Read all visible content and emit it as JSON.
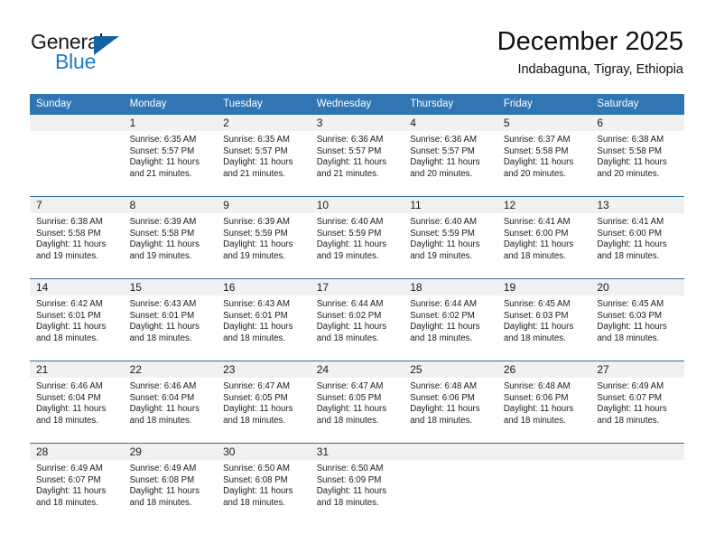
{
  "brand": {
    "name_part1": "General",
    "name_part2": "Blue",
    "accent_color": "#1d7ac4",
    "triangle_color": "#1464a5"
  },
  "header": {
    "title": "December 2025",
    "subtitle": "Indabaguna, Tigray, Ethiopia",
    "header_bg_color": "#3175b4"
  },
  "calendar": {
    "day_headers": [
      "Sunday",
      "Monday",
      "Tuesday",
      "Wednesday",
      "Thursday",
      "Friday",
      "Saturday"
    ],
    "weeks": [
      [
        {
          "day": "",
          "sunrise": "",
          "sunset": "",
          "daylight_line1": "",
          "daylight_line2": ""
        },
        {
          "day": "1",
          "sunrise": "Sunrise: 6:35 AM",
          "sunset": "Sunset: 5:57 PM",
          "daylight_line1": "Daylight: 11 hours",
          "daylight_line2": "and 21 minutes."
        },
        {
          "day": "2",
          "sunrise": "Sunrise: 6:35 AM",
          "sunset": "Sunset: 5:57 PM",
          "daylight_line1": "Daylight: 11 hours",
          "daylight_line2": "and 21 minutes."
        },
        {
          "day": "3",
          "sunrise": "Sunrise: 6:36 AM",
          "sunset": "Sunset: 5:57 PM",
          "daylight_line1": "Daylight: 11 hours",
          "daylight_line2": "and 21 minutes."
        },
        {
          "day": "4",
          "sunrise": "Sunrise: 6:36 AM",
          "sunset": "Sunset: 5:57 PM",
          "daylight_line1": "Daylight: 11 hours",
          "daylight_line2": "and 20 minutes."
        },
        {
          "day": "5",
          "sunrise": "Sunrise: 6:37 AM",
          "sunset": "Sunset: 5:58 PM",
          "daylight_line1": "Daylight: 11 hours",
          "daylight_line2": "and 20 minutes."
        },
        {
          "day": "6",
          "sunrise": "Sunrise: 6:38 AM",
          "sunset": "Sunset: 5:58 PM",
          "daylight_line1": "Daylight: 11 hours",
          "daylight_line2": "and 20 minutes."
        }
      ],
      [
        {
          "day": "7",
          "sunrise": "Sunrise: 6:38 AM",
          "sunset": "Sunset: 5:58 PM",
          "daylight_line1": "Daylight: 11 hours",
          "daylight_line2": "and 19 minutes."
        },
        {
          "day": "8",
          "sunrise": "Sunrise: 6:39 AM",
          "sunset": "Sunset: 5:58 PM",
          "daylight_line1": "Daylight: 11 hours",
          "daylight_line2": "and 19 minutes."
        },
        {
          "day": "9",
          "sunrise": "Sunrise: 6:39 AM",
          "sunset": "Sunset: 5:59 PM",
          "daylight_line1": "Daylight: 11 hours",
          "daylight_line2": "and 19 minutes."
        },
        {
          "day": "10",
          "sunrise": "Sunrise: 6:40 AM",
          "sunset": "Sunset: 5:59 PM",
          "daylight_line1": "Daylight: 11 hours",
          "daylight_line2": "and 19 minutes."
        },
        {
          "day": "11",
          "sunrise": "Sunrise: 6:40 AM",
          "sunset": "Sunset: 5:59 PM",
          "daylight_line1": "Daylight: 11 hours",
          "daylight_line2": "and 19 minutes."
        },
        {
          "day": "12",
          "sunrise": "Sunrise: 6:41 AM",
          "sunset": "Sunset: 6:00 PM",
          "daylight_line1": "Daylight: 11 hours",
          "daylight_line2": "and 18 minutes."
        },
        {
          "day": "13",
          "sunrise": "Sunrise: 6:41 AM",
          "sunset": "Sunset: 6:00 PM",
          "daylight_line1": "Daylight: 11 hours",
          "daylight_line2": "and 18 minutes."
        }
      ],
      [
        {
          "day": "14",
          "sunrise": "Sunrise: 6:42 AM",
          "sunset": "Sunset: 6:01 PM",
          "daylight_line1": "Daylight: 11 hours",
          "daylight_line2": "and 18 minutes."
        },
        {
          "day": "15",
          "sunrise": "Sunrise: 6:43 AM",
          "sunset": "Sunset: 6:01 PM",
          "daylight_line1": "Daylight: 11 hours",
          "daylight_line2": "and 18 minutes."
        },
        {
          "day": "16",
          "sunrise": "Sunrise: 6:43 AM",
          "sunset": "Sunset: 6:01 PM",
          "daylight_line1": "Daylight: 11 hours",
          "daylight_line2": "and 18 minutes."
        },
        {
          "day": "17",
          "sunrise": "Sunrise: 6:44 AM",
          "sunset": "Sunset: 6:02 PM",
          "daylight_line1": "Daylight: 11 hours",
          "daylight_line2": "and 18 minutes."
        },
        {
          "day": "18",
          "sunrise": "Sunrise: 6:44 AM",
          "sunset": "Sunset: 6:02 PM",
          "daylight_line1": "Daylight: 11 hours",
          "daylight_line2": "and 18 minutes."
        },
        {
          "day": "19",
          "sunrise": "Sunrise: 6:45 AM",
          "sunset": "Sunset: 6:03 PM",
          "daylight_line1": "Daylight: 11 hours",
          "daylight_line2": "and 18 minutes."
        },
        {
          "day": "20",
          "sunrise": "Sunrise: 6:45 AM",
          "sunset": "Sunset: 6:03 PM",
          "daylight_line1": "Daylight: 11 hours",
          "daylight_line2": "and 18 minutes."
        }
      ],
      [
        {
          "day": "21",
          "sunrise": "Sunrise: 6:46 AM",
          "sunset": "Sunset: 6:04 PM",
          "daylight_line1": "Daylight: 11 hours",
          "daylight_line2": "and 18 minutes."
        },
        {
          "day": "22",
          "sunrise": "Sunrise: 6:46 AM",
          "sunset": "Sunset: 6:04 PM",
          "daylight_line1": "Daylight: 11 hours",
          "daylight_line2": "and 18 minutes."
        },
        {
          "day": "23",
          "sunrise": "Sunrise: 6:47 AM",
          "sunset": "Sunset: 6:05 PM",
          "daylight_line1": "Daylight: 11 hours",
          "daylight_line2": "and 18 minutes."
        },
        {
          "day": "24",
          "sunrise": "Sunrise: 6:47 AM",
          "sunset": "Sunset: 6:05 PM",
          "daylight_line1": "Daylight: 11 hours",
          "daylight_line2": "and 18 minutes."
        },
        {
          "day": "25",
          "sunrise": "Sunrise: 6:48 AM",
          "sunset": "Sunset: 6:06 PM",
          "daylight_line1": "Daylight: 11 hours",
          "daylight_line2": "and 18 minutes."
        },
        {
          "day": "26",
          "sunrise": "Sunrise: 6:48 AM",
          "sunset": "Sunset: 6:06 PM",
          "daylight_line1": "Daylight: 11 hours",
          "daylight_line2": "and 18 minutes."
        },
        {
          "day": "27",
          "sunrise": "Sunrise: 6:49 AM",
          "sunset": "Sunset: 6:07 PM",
          "daylight_line1": "Daylight: 11 hours",
          "daylight_line2": "and 18 minutes."
        }
      ],
      [
        {
          "day": "28",
          "sunrise": "Sunrise: 6:49 AM",
          "sunset": "Sunset: 6:07 PM",
          "daylight_line1": "Daylight: 11 hours",
          "daylight_line2": "and 18 minutes."
        },
        {
          "day": "29",
          "sunrise": "Sunrise: 6:49 AM",
          "sunset": "Sunset: 6:08 PM",
          "daylight_line1": "Daylight: 11 hours",
          "daylight_line2": "and 18 minutes."
        },
        {
          "day": "30",
          "sunrise": "Sunrise: 6:50 AM",
          "sunset": "Sunset: 6:08 PM",
          "daylight_line1": "Daylight: 11 hours",
          "daylight_line2": "and 18 minutes."
        },
        {
          "day": "31",
          "sunrise": "Sunrise: 6:50 AM",
          "sunset": "Sunset: 6:09 PM",
          "daylight_line1": "Daylight: 11 hours",
          "daylight_line2": "and 18 minutes."
        },
        {
          "day": "",
          "sunrise": "",
          "sunset": "",
          "daylight_line1": "",
          "daylight_line2": ""
        },
        {
          "day": "",
          "sunrise": "",
          "sunset": "",
          "daylight_line1": "",
          "daylight_line2": ""
        },
        {
          "day": "",
          "sunrise": "",
          "sunset": "",
          "daylight_line1": "",
          "daylight_line2": ""
        }
      ]
    ]
  }
}
